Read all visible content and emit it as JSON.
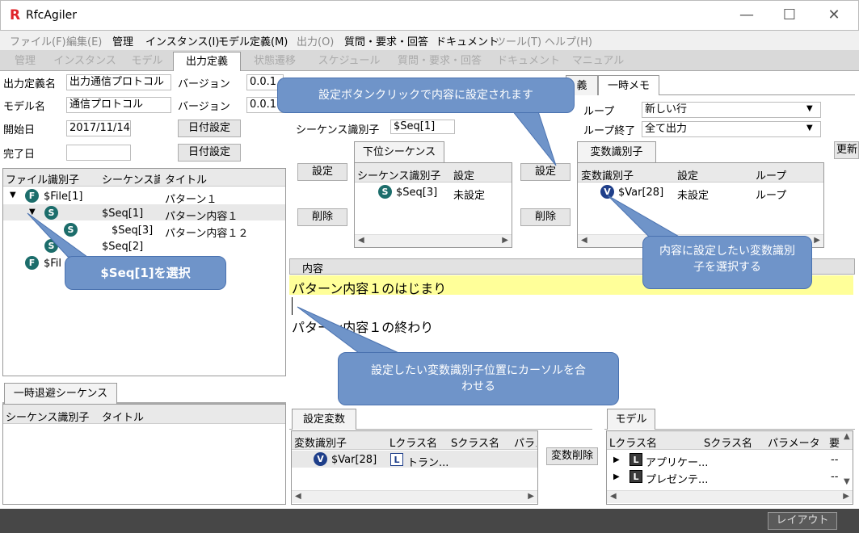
{
  "window": {
    "title": "RfcAgiler",
    "logo": "R",
    "minimize": "—",
    "maximize": "☐",
    "close": "✕"
  },
  "menu": [
    "ファイル(F)",
    "編集(E)",
    "管理",
    "インスタンス(I)",
    "モデル定義(M)",
    "出力(O)",
    "質問・要求・回答",
    "ドキュメント",
    "ツール(T)",
    "ヘルプ(H)"
  ],
  "tabs": [
    "管理",
    "インスタンス",
    "モデル",
    "出力定義",
    "状態遷移",
    "スケジュール",
    "質問・要求・回答",
    "ドキュメント",
    "マニュアル"
  ],
  "form": {
    "def_name_label": "出力定義名",
    "def_name_value": "出力通信プロトコル",
    "version_label": "バージョン",
    "version_value1": "0.0.1",
    "model_name_label": "モデル名",
    "model_name_value": "通信プロトコル",
    "version_value2": "0.0.1",
    "start_label": "開始日",
    "start_value": "2017/11/14",
    "date_btn": "日付設定",
    "end_label": "完了日",
    "end_value": ""
  },
  "left_grid": {
    "headers": [
      "ファイル識別子",
      "シーケンス識別",
      "タイトル"
    ],
    "rows": [
      {
        "ident": "$File[1]",
        "seq": "",
        "title": "パターン１"
      },
      {
        "ident": "",
        "seq": "$Seq[1]",
        "title": "パターン内容１"
      },
      {
        "ident": "",
        "seq": "$Seq[3]",
        "title": "パターン内容１２"
      },
      {
        "ident": "",
        "seq": "$Seq[2]",
        "title": ""
      },
      {
        "ident": "$Fil",
        "seq": "",
        "title": ""
      }
    ]
  },
  "temp_seq": {
    "tab": "一時退避シーケンス",
    "headers": [
      "シーケンス識別子",
      "タイトル"
    ]
  },
  "right_tabs": {
    "tab_partial": "義",
    "memo": "一時メモ"
  },
  "seq_panel": {
    "seq_label": "シーケンス識別子",
    "seq_value": "$Seq[1]",
    "loop_label": "ループ",
    "loop_value": "新しい行",
    "loop_end_label": "ループ終了",
    "loop_end_value": "全て出力",
    "sub_tab": "下位シーケンス",
    "set_btn": "設定",
    "del_btn": "削除",
    "sub_headers": [
      "シーケンス識別子",
      "設定"
    ],
    "sub_row": {
      "ident": "$Seq[3]",
      "set": "未設定"
    },
    "var_tab": "変数識別子",
    "update_btn": "更新",
    "var_headers": [
      "変数識別子",
      "設定",
      "ループ"
    ],
    "var_row": {
      "ident": "$Var[28]",
      "set": "未設定",
      "loop": "ループ"
    }
  },
  "content": {
    "label": "内容",
    "line1": "パターン内容１のはじまり",
    "line2": "パターン内容１の終わり"
  },
  "set_vars": {
    "tab": "設定変数",
    "headers": [
      "変数識別子",
      "Lクラス名",
      "Sクラス名",
      "パラメ"
    ],
    "row": {
      "ident": "$Var[28]",
      "lclass": "トラン..."
    },
    "delete_btn": "変数削除"
  },
  "model_panel": {
    "tab": "モデル",
    "headers": [
      "Lクラス名",
      "Sクラス名",
      "パラメータ",
      "要"
    ],
    "rows": [
      "アプリケー...",
      "プレゼンテ..."
    ],
    "dash": "--"
  },
  "status": {
    "layout_btn": "レイアウト"
  },
  "callouts": {
    "c1": "設定ボタンクリックで内容に設定されます",
    "c2": "$Seq[1]を選択",
    "c3": "内容に設定したい変数識別子を選択する",
    "c4": "設定したい変数識別子位置にカーソルを合わせる"
  }
}
